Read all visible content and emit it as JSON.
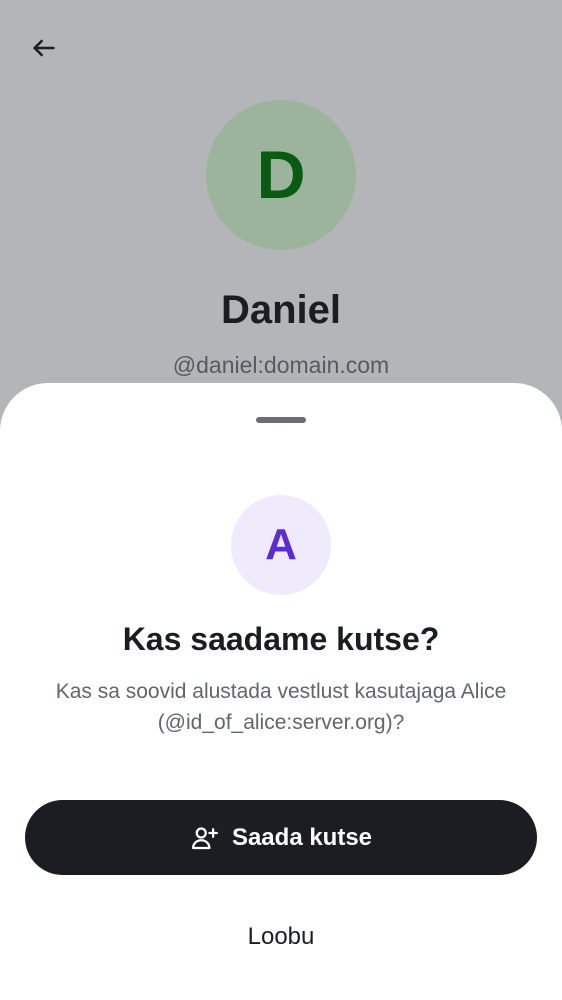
{
  "background_profile": {
    "avatar_letter": "D",
    "name": "Daniel",
    "handle": "@daniel:domain.com"
  },
  "icons": {
    "back": "arrow-left-icon",
    "invite": "user-plus-icon"
  },
  "sheet": {
    "avatar_letter": "A",
    "title": "Kas saadame kutse?",
    "description": "Kas sa soovid alustada vestlust kasutajaga Alice (@id_of_alice:server.org)?",
    "primary_button_label": "Saada kutse",
    "secondary_button_label": "Loobu"
  },
  "colors": {
    "scrim": "#b4b5b8",
    "profile_avatar_bg": "#9cb39c",
    "profile_avatar_text": "#0b5a12",
    "invite_avatar_bg": "#efebfd",
    "invite_avatar_text": "#5a2cd1",
    "primary_button_bg": "#1b1d22"
  }
}
